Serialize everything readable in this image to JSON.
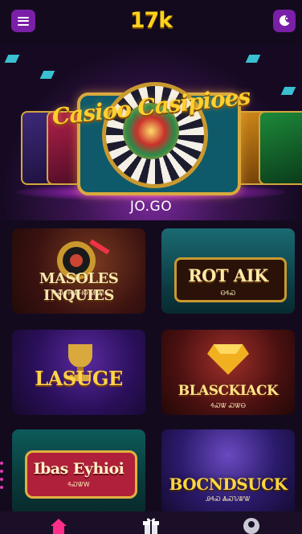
{
  "header": {
    "logo_text": "17k",
    "menu_icon": "hamburger-menu-icon",
    "theme_icon": "moon-icon"
  },
  "hero": {
    "title": "Casioo Casipioes",
    "brand_text": "JO.GO",
    "accent_color": "#ffcf2e"
  },
  "games": [
    {
      "title": "MASOLES INQUIES",
      "subtitle": "ᏎᏍ ᎰᏒᏔᎻᎾ ᎷᎧᎬ"
    },
    {
      "title": "ROT AIK",
      "subtitle": "ᎾᏎᏍ"
    },
    {
      "title": "LASUGE",
      "subtitle": ""
    },
    {
      "title": "BLASCKIACK",
      "subtitle": "ᏎᏍᏔ ᏍᏔᎾ"
    },
    {
      "title": "Ibas Eyhioi",
      "subtitle": "ᏎᏍᏔᎳ"
    },
    {
      "title": "BOCNDSUCK",
      "subtitle": "ᎯᏎᏍ ᏜᏍᏖᏔᏔ"
    }
  ],
  "navbar": {
    "items": [
      {
        "icon": "home-icon",
        "active": true
      },
      {
        "icon": "gift-icon",
        "active": false
      },
      {
        "icon": "profile-icon",
        "active": false
      }
    ]
  }
}
